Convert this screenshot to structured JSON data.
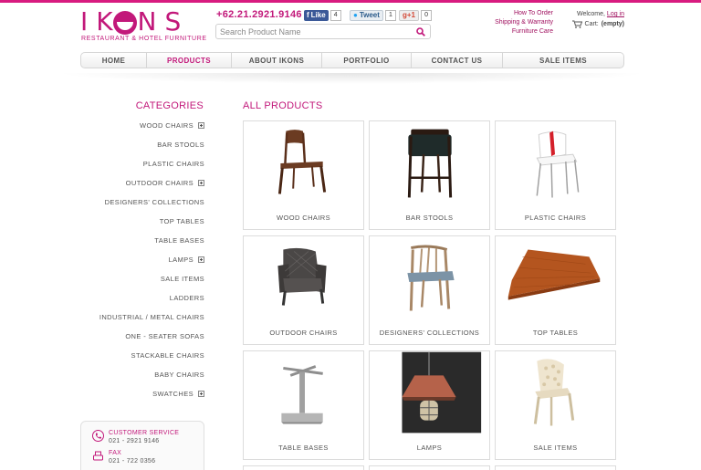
{
  "brand": {
    "logo_word": "IK  NS",
    "tagline": "RESTAURANT & HOTEL FURNITURE",
    "phone": "+62.21.2921.9146",
    "accent_color": "#c2187a"
  },
  "social": {
    "facebook_label": "Like",
    "facebook_count": "4",
    "twitter_label": "Tweet",
    "twitter_count": "1",
    "gplus_label": "g+1",
    "gplus_count": "0"
  },
  "search": {
    "placeholder": "Search Product Name",
    "icon": "search-icon"
  },
  "header_links": [
    "How To Order",
    "Shipping & Warranty",
    "Furniture Care"
  ],
  "account": {
    "welcome": "Welcome,",
    "login": "Log in",
    "cart_label": "Cart:",
    "cart_value": "(empty)"
  },
  "nav": [
    {
      "label": "HOME",
      "active": false
    },
    {
      "label": "PRODUCTS",
      "active": true
    },
    {
      "label": "ABOUT IKONS",
      "active": false
    },
    {
      "label": "PORTFOLIO",
      "active": false
    },
    {
      "label": "CONTACT US",
      "active": false
    },
    {
      "label": "SALE ITEMS",
      "active": false
    }
  ],
  "categories": {
    "title": "CATEGORIES",
    "items": [
      {
        "label": "WOOD CHAIRS",
        "expandable": true
      },
      {
        "label": "BAR STOOLS",
        "expandable": false
      },
      {
        "label": "PLASTIC CHAIRS",
        "expandable": false
      },
      {
        "label": "OUTDOOR CHAIRS",
        "expandable": true
      },
      {
        "label": "DESIGNERS' COLLECTIONS",
        "expandable": false
      },
      {
        "label": "TOP TABLES",
        "expandable": false
      },
      {
        "label": "TABLE BASES",
        "expandable": false
      },
      {
        "label": "LAMPS",
        "expandable": true
      },
      {
        "label": "SALE ITEMS",
        "expandable": false
      },
      {
        "label": "LADDERS",
        "expandable": false
      },
      {
        "label": "INDUSTRIAL / METAL CHAIRS",
        "expandable": false
      },
      {
        "label": "ONE - SEATER SOFAS",
        "expandable": false
      },
      {
        "label": "STACKABLE CHAIRS",
        "expandable": false
      },
      {
        "label": "BABY CHAIRS",
        "expandable": false
      },
      {
        "label": "SWATCHES",
        "expandable": true
      }
    ]
  },
  "contact": {
    "service_label": "CUSTOMER SERVICE",
    "service_value": "021 - 2921 9146",
    "fax_label": "FAX",
    "fax_value": "021 - 722 0356"
  },
  "products": {
    "title": "ALL PRODUCTS",
    "items": [
      {
        "label": "WOOD CHAIRS",
        "image": "wood-chair"
      },
      {
        "label": "BAR STOOLS",
        "image": "bar-stool"
      },
      {
        "label": "PLASTIC CHAIRS",
        "image": "plastic-chair"
      },
      {
        "label": "OUTDOOR CHAIRS",
        "image": "outdoor-chair"
      },
      {
        "label": "DESIGNERS' COLLECTIONS",
        "image": "designer-chair"
      },
      {
        "label": "TOP TABLES",
        "image": "table-top"
      },
      {
        "label": "TABLE BASES",
        "image": "table-base"
      },
      {
        "label": "LAMPS",
        "image": "pendant-lamp"
      },
      {
        "label": "SALE ITEMS",
        "image": "lattice-chair"
      }
    ]
  }
}
